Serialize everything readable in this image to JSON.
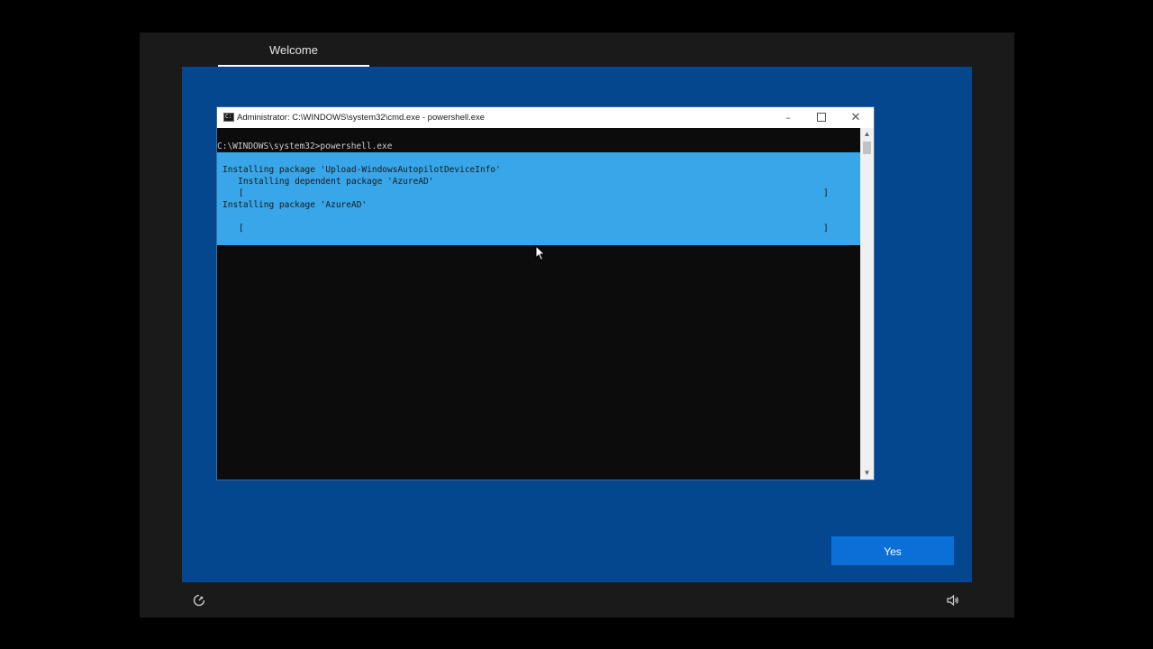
{
  "oobe": {
    "tab_label": "Welcome",
    "yes_button": "Yes",
    "icons": {
      "ease_of_access": "accessibility-icon",
      "volume": "volume-icon"
    }
  },
  "cmd_window": {
    "title": "Administrator: C:\\WINDOWS\\system32\\cmd.exe - powershell.exe",
    "icon": "cmd-icon",
    "buttons": {
      "minimize": "minimize-icon",
      "maximize": "maximize-icon",
      "close": "close-icon"
    },
    "prompt_line": "C:\\WINDOWS\\system32>powershell.exe",
    "progress": {
      "line1": "Installing package 'Upload-WindowsAutopilotDeviceInfo'",
      "line2": "   Installing dependent package 'AzureAD'",
      "bar1_open": "[",
      "bar1_close": "]",
      "line3": "Installing package 'AzureAD'",
      "bar2_open": "[",
      "bar2_close": "]"
    }
  },
  "colors": {
    "oobe_blue": "#05478f",
    "progress_cyan": "#38a6e8",
    "button_blue": "#0b6fd8",
    "console_bg": "#0c0c0c"
  }
}
